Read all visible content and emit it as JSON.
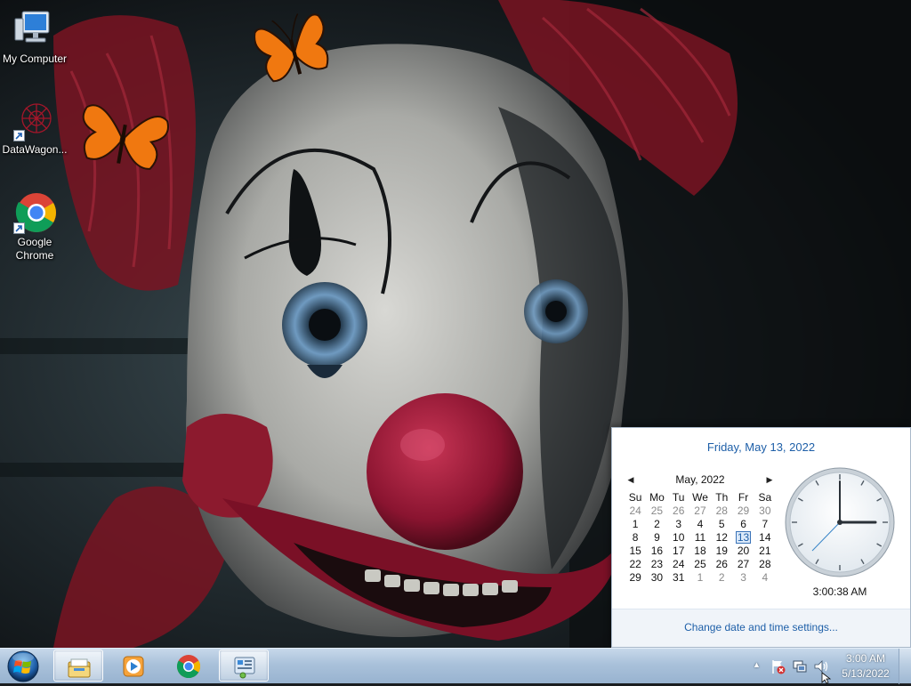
{
  "desktop": {
    "icons": [
      {
        "label": "My Computer"
      },
      {
        "label": "DataWagon..."
      },
      {
        "label": "Google Chrome"
      }
    ]
  },
  "flyout": {
    "long_date": "Friday, May 13, 2022",
    "month_label": "May, 2022",
    "prev_arrow": "◀",
    "next_arrow": "▶",
    "weekdays": [
      "Su",
      "Mo",
      "Tu",
      "We",
      "Th",
      "Fr",
      "Sa"
    ],
    "weeks": [
      [
        "24",
        "25",
        "26",
        "27",
        "28",
        "29",
        "30"
      ],
      [
        "1",
        "2",
        "3",
        "4",
        "5",
        "6",
        "7"
      ],
      [
        "8",
        "9",
        "10",
        "11",
        "12",
        "13",
        "14"
      ],
      [
        "15",
        "16",
        "17",
        "18",
        "19",
        "20",
        "21"
      ],
      [
        "22",
        "23",
        "24",
        "25",
        "26",
        "27",
        "28"
      ],
      [
        "29",
        "30",
        "31",
        "1",
        "2",
        "3",
        "4"
      ]
    ],
    "today": "13",
    "time": "3:00:38 AM",
    "settings_link": "Change date and time settings..."
  },
  "taskbar": {
    "pinned": [
      {
        "icon": "windows-explorer-icon",
        "active": true
      },
      {
        "icon": "media-player-icon",
        "active": false
      },
      {
        "icon": "chrome-icon",
        "active": false
      },
      {
        "icon": "control-panel-icon",
        "active": true
      }
    ],
    "tray": {
      "show_hidden": "▲",
      "icons": [
        "action-center-flag-icon",
        "network-icon",
        "volume-icon"
      ]
    },
    "clock_time": "3:00 AM",
    "clock_date": "5/13/2022"
  },
  "colors": {
    "link_blue": "#1e5fa8",
    "taskbar_top": "#c7d8ea",
    "taskbar_bottom": "#98b3d0"
  }
}
